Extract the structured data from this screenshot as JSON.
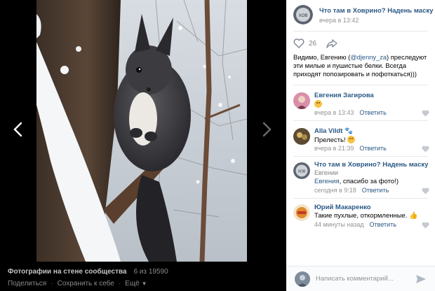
{
  "viewer": {
    "album_title": "Фотографии на стене сообщества",
    "counter": "6 из 19590",
    "actions": {
      "share": "Поделиться",
      "save": "Сохранить к себе",
      "more": "Ещё"
    }
  },
  "post": {
    "author": "Что там в Ховрино? Надень маску",
    "time": "вчера в 13:42",
    "likes": "26",
    "text_before": "Видимо, Евгению (",
    "mention": "@djenny_za",
    "text_after": ") преследуют эти милые и пушистые белки. Всегда приходят попозировать и пофоткаться)))"
  },
  "comments": [
    {
      "author": "Евгения Загирова",
      "text": "",
      "time": "вчера в 13:43",
      "reply": "Ответить"
    },
    {
      "author": "Alla Vildt",
      "text": "Прелесть!",
      "time": "вчера в 21:39",
      "reply": "Ответить"
    },
    {
      "author": "Что там в Ховрино? Надень маску",
      "to": "Евгении",
      "mention": "Евгения",
      "text": ", спасибо за фото!)",
      "time": "сегодня в 9:18",
      "reply": "Ответить"
    },
    {
      "author": "Юрий Макаренко",
      "text": "Такие пухлые, откормленные.",
      "time": "44 минуты назад",
      "reply": "Ответить"
    }
  ],
  "composer": {
    "placeholder": "Написать комментарий..."
  },
  "colors": {
    "link": "#2a5885",
    "viewer_bg": "#000000",
    "footer_bg": "#1f1f1f"
  },
  "icons": [
    "chevron-left-icon",
    "chevron-right-icon",
    "heart-icon",
    "share-icon",
    "like-icon",
    "send-icon"
  ]
}
